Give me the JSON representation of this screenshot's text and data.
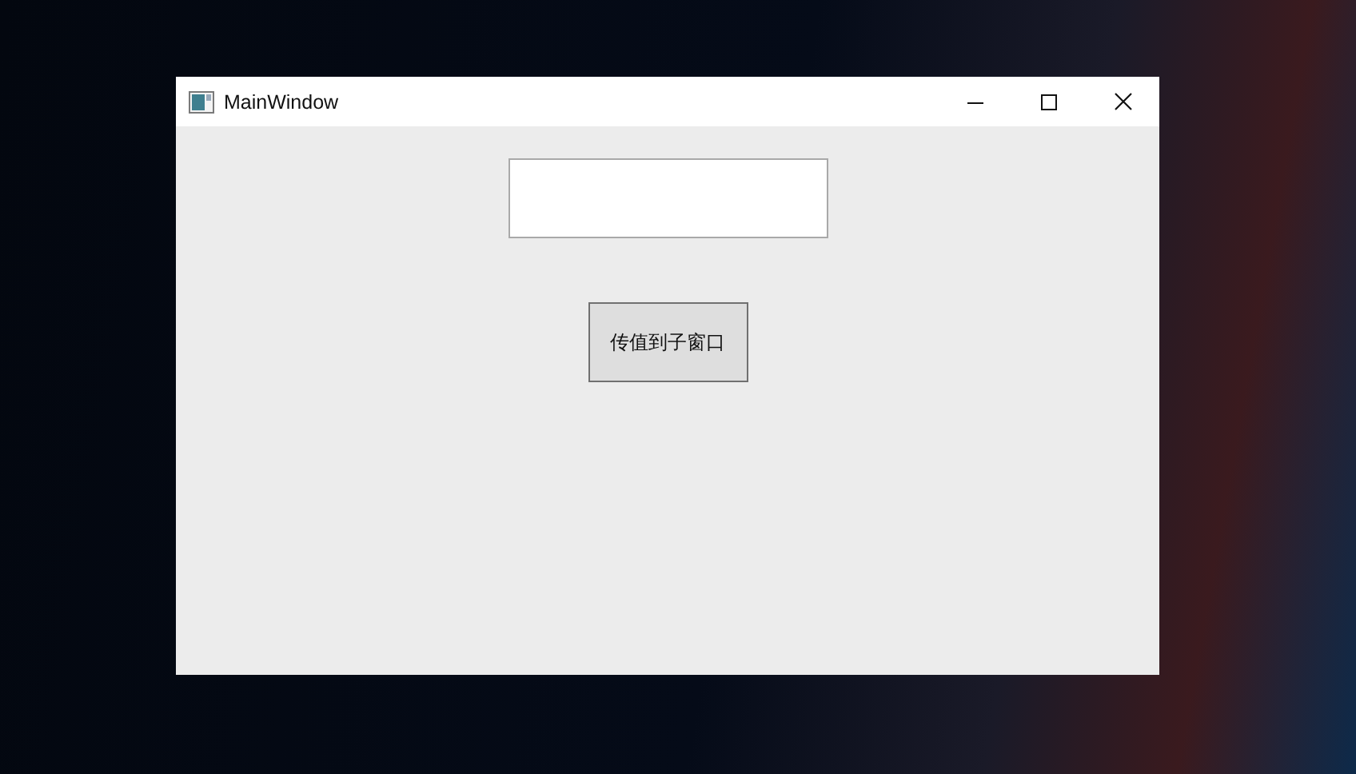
{
  "window": {
    "title": "MainWindow"
  },
  "button": {
    "label": "传值到子窗口"
  }
}
